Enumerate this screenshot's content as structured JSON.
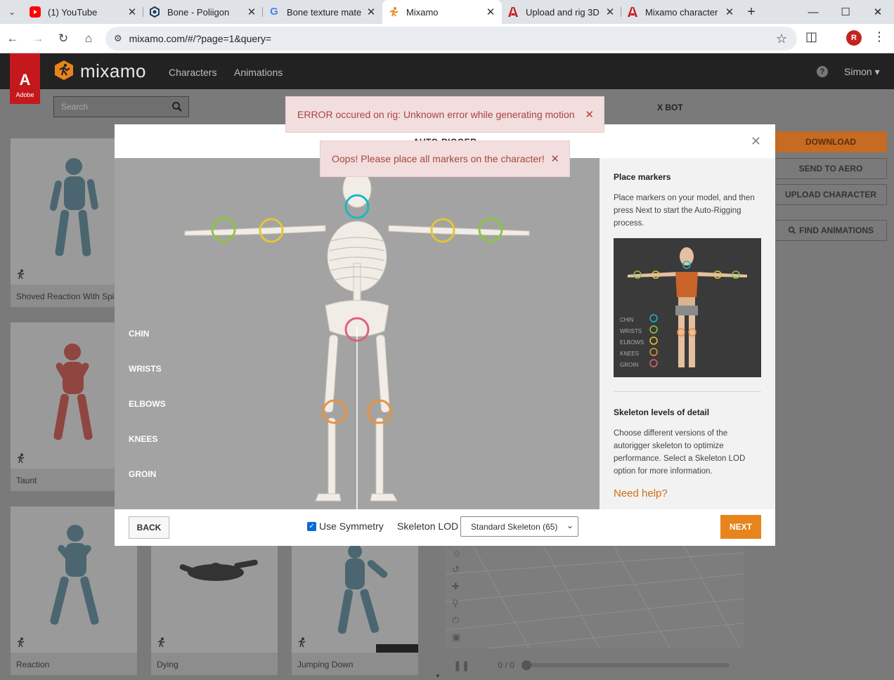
{
  "browser": {
    "tabs": [
      {
        "title": "(1) YouTube",
        "icon": "youtube-icon",
        "color": "#ff0000"
      },
      {
        "title": "Bone - Poliigon",
        "icon": "poliigon-icon",
        "color": "#1a3a5c"
      },
      {
        "title": "Bone texture mate",
        "icon": "google-icon",
        "color": "#4285f4"
      },
      {
        "title": "Mixamo",
        "icon": "mixamo-icon",
        "color": "#e8841c"
      },
      {
        "title": "Upload and rig 3D",
        "icon": "adobe-icon",
        "color": "#c4181d"
      },
      {
        "title": "Mixamo character",
        "icon": "adobe-icon",
        "color": "#c4181d"
      }
    ],
    "active_tab": 3,
    "url": "mixamo.com/#/?page=1&query=",
    "profile_initials": "R"
  },
  "header": {
    "adobe_label": "Adobe",
    "brand": "mixamo",
    "nav": [
      "Characters",
      "Animations"
    ],
    "user": "Simon ▾"
  },
  "search": {
    "placeholder": "Search"
  },
  "cards": [
    {
      "caption": "Shoved Reaction With Spin"
    },
    {
      "caption": "Taunt"
    },
    {
      "caption": "Reaction"
    },
    {
      "caption": "Dying"
    },
    {
      "caption": "Jumping Down"
    }
  ],
  "right_panel": {
    "character_title": "X BOT",
    "download": "DOWNLOAD",
    "send_aero": "SEND TO AERO",
    "upload": "UPLOAD CHARACTER",
    "find": "FIND ANIMATIONS",
    "playback": "0 / 0"
  },
  "modal": {
    "title": "AUTO-RIGGER",
    "marker_labels": [
      "CHIN",
      "WRISTS",
      "ELBOWS",
      "KNEES",
      "GROIN"
    ],
    "place_markers_heading": "Place markers",
    "place_markers_text": "Place markers on your model, and then press Next to start the Auto-Rigging process.",
    "lod_heading": "Skeleton levels of detail",
    "lod_text": "Choose different versions of the autorigger skeleton to optimize performance. Select a Skeleton LOD option for more information.",
    "help_link": "Need help?",
    "back": "BACK",
    "use_symmetry": "Use Symmetry",
    "use_symmetry_checked": true,
    "lod_label": "Skeleton LOD",
    "lod_value": "Standard Skeleton (65)",
    "next": "NEXT",
    "ref_legend": [
      "CHIN",
      "WRISTS",
      "ELBOWS",
      "KNEES",
      "GROIN"
    ]
  },
  "marker_colors": {
    "chin": "#19b8c4",
    "wrists": "#8cc63f",
    "elbows": "#e3c53a",
    "knees": "#e8923a",
    "groin": "#e0607e"
  },
  "alerts": {
    "error": "ERROR occured on rig: Unknown error while generating motion",
    "oops": "Oops! Please place all markers on the character!"
  }
}
